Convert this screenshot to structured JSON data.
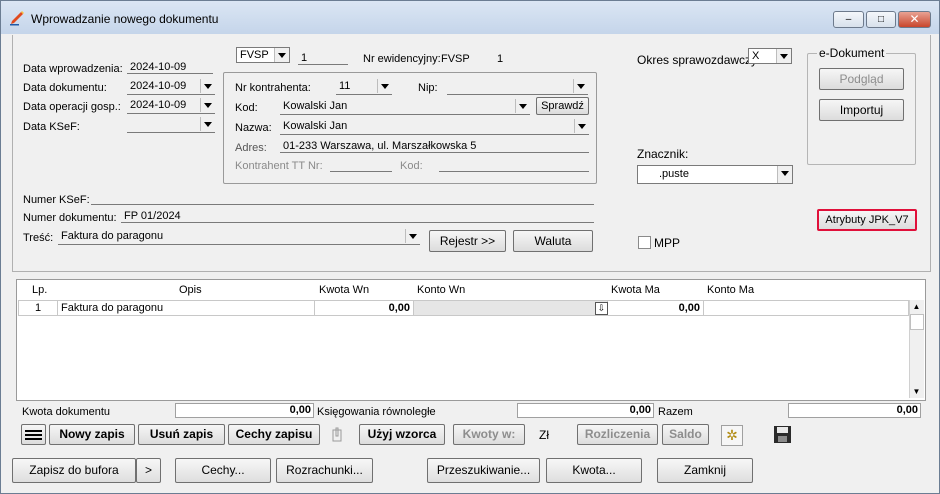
{
  "window": {
    "title": "Wprowadzanie nowego dokumentu",
    "minimize_glyph": "–",
    "maximize_glyph": "□",
    "close_glyph": "✕"
  },
  "header": {
    "doc_type": "FVSP",
    "doc_number": "1",
    "record_label": "Nr ewidencyjny:",
    "record_value": "FVSP",
    "record_number": "1",
    "dates": {
      "entry_label": "Data wprowadzenia:",
      "entry_value": "2024-10-09",
      "document_label": "Data dokumentu:",
      "document_value": "2024-10-09",
      "operation_label": "Data operacji gosp.:",
      "operation_value": "2024-10-09",
      "ksef_label": "Data KSeF:",
      "ksef_value": ""
    }
  },
  "contractor": {
    "nr_label": "Nr kontrahenta:",
    "nr_value": "11",
    "nip_label": "Nip:",
    "nip_value": "",
    "kod_label": "Kod:",
    "kod_value": "Kowalski Jan",
    "check_button": "Sprawdź",
    "nazwa_label": "Nazwa:",
    "nazwa_value": "Kowalski Jan",
    "adres_label": "Adres:",
    "adres_value": "01-233 Warszawa, ul. Marszałkowska 5",
    "tt_label": "Kontrahent TT Nr:",
    "tt_kod_label": "Kod:"
  },
  "right": {
    "period_label": "Okres sprawozdawczy:",
    "period_value": "X",
    "edoc_title": "e-Dokument",
    "preview_button": "Podgląd",
    "import_button": "Importuj",
    "marker_label": "Znacznik:",
    "marker_value": ".puste",
    "jpk_button": "Atrybuty JPK_V7",
    "mpp_label": "MPP",
    "mpp_checked": false
  },
  "details": {
    "ksef_number_label": "Numer KSeF:",
    "ksef_number_value": "",
    "doc_number_label": "Numer dokumentu:",
    "doc_number_value": "FP 01/2024",
    "content_label": "Treść:",
    "content_value": "Faktura do paragonu",
    "register_button": "Rejestr >>",
    "currency_button": "Waluta"
  },
  "grid": {
    "columns": [
      "Lp.",
      "Opis",
      "Kwota  Wn",
      "Konto  Wn",
      "Kwota Ma",
      "Konto Ma"
    ],
    "rows": [
      {
        "lp": "1",
        "opis": "Faktura do paragonu",
        "kwota_wn": "0,00",
        "konto_wn": "",
        "kwota_ma": "0,00",
        "konto_ma": ""
      }
    ]
  },
  "totals": {
    "doc_amount_label": "Kwota dokumentu",
    "doc_amount_value": "0,00",
    "parallel_label": "Księgowania równoległe",
    "parallel_value": "0,00",
    "sum_label": "Razem",
    "sum_value": "0,00"
  },
  "toolbar": {
    "new_entry": "Nowy zapis",
    "delete_entry": "Usuń zapis",
    "entry_features": "Cechy zapisu",
    "use_template": "Użyj wzorca",
    "amounts": "Kwoty w:",
    "currency": "Zł",
    "settlements": "Rozliczenia",
    "balance": "Saldo"
  },
  "bottom": {
    "save_buffer": "Zapisz do bufora",
    "more": ">",
    "features": "Cechy...",
    "settlements": "Rozrachunki...",
    "search": "Przeszukiwanie...",
    "amount": "Kwota...",
    "close": "Zamknij"
  },
  "colors": {
    "highlight": "#e0103a",
    "titlebar": "#c5d5ea"
  }
}
